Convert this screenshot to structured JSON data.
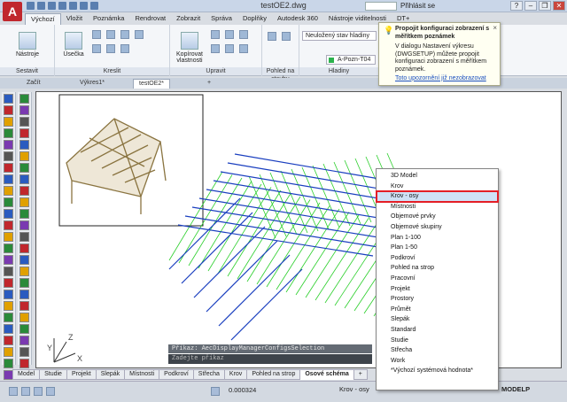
{
  "app": {
    "logo_letter": "A",
    "title": "testOE2.dwg"
  },
  "titlebar": {
    "search_placeholder": "",
    "signin": "Přihlásit se",
    "help": "?"
  },
  "ribbon_tabs": [
    "Výchozí",
    "Vložit",
    "Poznámka",
    "Rendrovat",
    "Zobrazit",
    "Správa",
    "Doplňky",
    "Autodesk 360",
    "Nástroje viditelnosti",
    "DT+"
  ],
  "ribbon": {
    "panels": [
      {
        "label": "Sestavit",
        "tool": "Nástroje"
      },
      {
        "label": "Kreslit",
        "tool": "Úsečka"
      },
      {
        "label": "Upravit",
        "tool": "Kopírovat vlastnosti"
      },
      {
        "label": "Pohled na stavbu"
      },
      {
        "label": "Hladiny"
      }
    ],
    "layer_state": "Neuložený stav hladiny",
    "current_layer": "A-Pozn-T04"
  },
  "tooltip": {
    "title": "Propojit konfiguraci zobrazení s měřítkem poznámek",
    "body": "V dialogu Nastavení výkresu (DWGSETUP) můžete propojit konfiguraci zobrazení s měřítkem poznámek.",
    "link": "Toto upozornění již nezobrazovat",
    "close": "×"
  },
  "doc_tabs": [
    "Začít",
    "Výkres1*",
    "testOE2*",
    "+"
  ],
  "command": {
    "history": "Příkaz: AecDisplayManagerConfigsSelection",
    "prompt": "Zadejte příkaz"
  },
  "layout_tabs": [
    "Model",
    "Studie",
    "Projekt",
    "Slepák",
    "Místnosti",
    "Podkroví",
    "Střecha",
    "Krov",
    "Pohled na strop",
    "Osové schéma",
    "+"
  ],
  "status": {
    "coords": "0.000324",
    "dropdown": "Krov - osy",
    "model": "MODELP"
  },
  "popup_menu": {
    "items": [
      "3D Model",
      "Krov",
      "Krov - osy",
      "Místnosti",
      "Objemové prvky",
      "Objemové skupiny",
      "Plan 1-100",
      "Plan 1-50",
      "Podkroví",
      "Pohled na strop",
      "Pracovní",
      "Projekt",
      "Prostory",
      "Průmět",
      "Slepák",
      "Standard",
      "Studie",
      "Střecha",
      "Work",
      "*Výchozí systémová hodnota*"
    ],
    "highlighted": "Krov - osy"
  },
  "colors": {
    "accent": "#c0272d",
    "highlight_outline": "#e41e26",
    "drawing_lines_green": "#2bcf2b",
    "drawing_lines_blue": "#1a3fbf"
  }
}
